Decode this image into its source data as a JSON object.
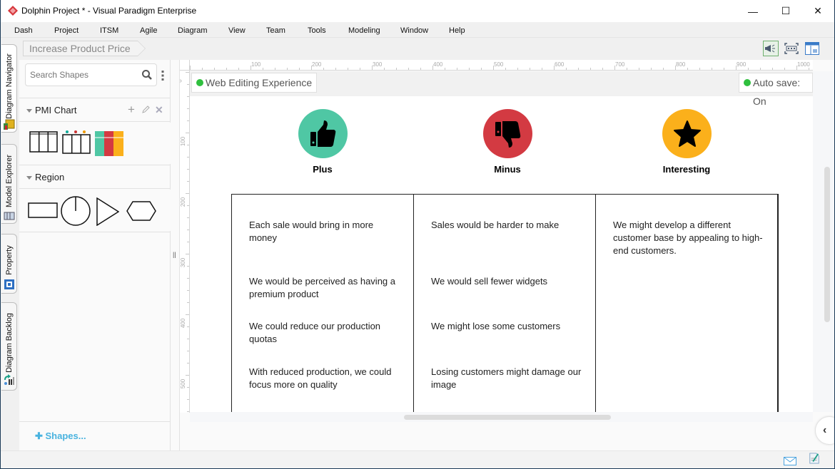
{
  "window": {
    "title": "Dolphin Project * - Visual Paradigm Enterprise",
    "controls": {
      "minimize": "—",
      "maximize": "☐",
      "close": "✕"
    }
  },
  "menubar": [
    "Dash",
    "Project",
    "ITSM",
    "Agile",
    "Diagram",
    "View",
    "Team",
    "Tools",
    "Modeling",
    "Window",
    "Help"
  ],
  "breadcrumb": {
    "label": "Increase Product Price"
  },
  "toolbar": {
    "icons": [
      "megaphone-icon",
      "fit-to-window-icon",
      "layer-panel-icon"
    ]
  },
  "side_tabs": [
    "Diagram Navigator",
    "Model Explorer",
    "Property",
    "Diagram Backlog"
  ],
  "shapes_panel": {
    "search_placeholder": "Search Shapes",
    "sections": [
      {
        "title": "PMI Chart",
        "shapes": [
          "pmi-table-plain",
          "pmi-table-dots",
          "pmi-table-colored"
        ]
      },
      {
        "title": "Region",
        "shapes": [
          "rectangle",
          "circle-region",
          "triangle",
          "hexagon"
        ]
      }
    ],
    "add_shapes_label": "Shapes..."
  },
  "rulers": {
    "horizontal": [
      "100",
      "200",
      "300",
      "400",
      "500",
      "600",
      "700",
      "800",
      "900",
      "1000"
    ],
    "vertical": [
      "0",
      "100",
      "200",
      "300",
      "400",
      "500"
    ]
  },
  "canvas": {
    "web_editing_label": "Web Editing Experience",
    "auto_save_label": "Auto save: On",
    "status_dot_color": "#2fbf3e"
  },
  "pmi": {
    "categories": [
      {
        "label": "Plus",
        "color": "#4fc7a4",
        "icon": "thumbs-up-icon",
        "items": [
          "Each sale would bring in more money",
          "We would be perceived as having a premium product",
          "We could reduce our production quotas",
          "With reduced production, we could focus more on quality"
        ]
      },
      {
        "label": "Minus",
        "color": "#d33a42",
        "icon": "thumbs-down-icon",
        "items": [
          "Sales would be harder to make",
          "We would sell fewer widgets",
          "We might lose some customers",
          "Losing customers might damage our image"
        ]
      },
      {
        "label": "Interesting",
        "color": "#fbb01b",
        "icon": "star-icon",
        "items": [
          "We might develop a different customer base by appealing to high-end customers."
        ]
      }
    ]
  },
  "statusbar": {
    "icons": [
      "mail-icon",
      "notes-icon"
    ]
  }
}
